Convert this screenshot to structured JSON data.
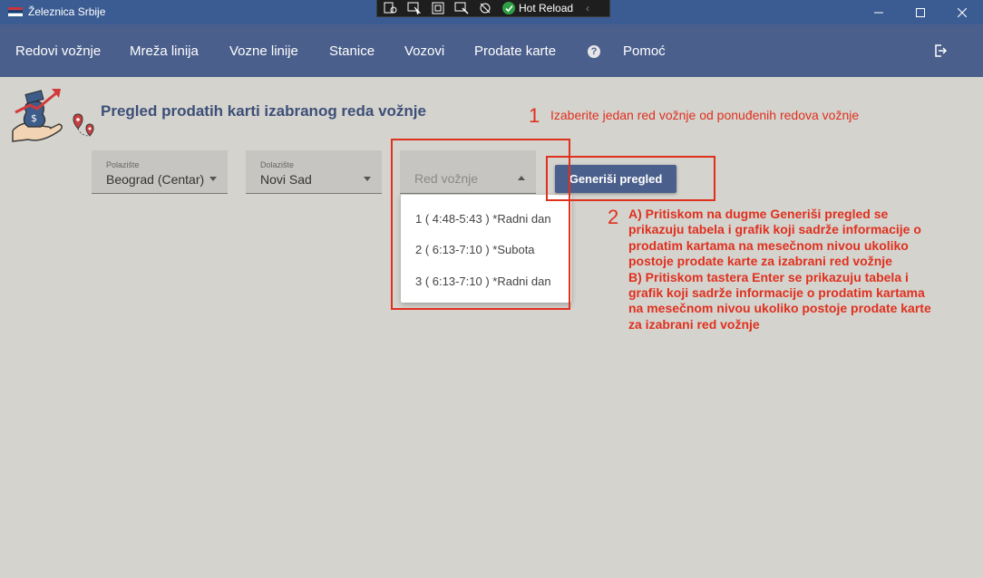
{
  "window": {
    "title": "Železnica Srbije",
    "flag_icon": "serbia-flag-icon",
    "controls": [
      "minimize-icon",
      "maximize-icon",
      "close-icon"
    ]
  },
  "debug_toolbar": {
    "icons": [
      "live-visual-tree-icon",
      "select-element-icon",
      "display-layout-adorners-icon",
      "track-focus-icon",
      "binding-failures-icon"
    ],
    "hot_reload_label": "Hot Reload"
  },
  "menu": {
    "items": [
      "Redovi vožnje",
      "Mreža linija",
      "Vozne linije",
      "Stanice",
      "Vozovi",
      "Prodate karte"
    ],
    "help_icon": "?",
    "help_label": "Pomoć",
    "logout_icon": "logout-icon"
  },
  "page": {
    "title": "Pregled prodatih karti izabranog reda vožnje",
    "logo_icon": "ticket-sales-logo-icon"
  },
  "filters": {
    "departure": {
      "label": "Polazište",
      "value": "Beograd (Centar)"
    },
    "arrival": {
      "label": "Dolazište",
      "value": "Novi Sad"
    },
    "schedule": {
      "placeholder": "Red vožnje",
      "options": [
        "1 ( 4:48-5:43 ) *Radni dan",
        "2 ( 6:13-7:10 ) *Subota",
        "3 ( 6:13-7:10 ) *Radni dan"
      ]
    }
  },
  "generate_button": {
    "label": "Generiši pregled"
  },
  "annotations": {
    "step1_number": "1",
    "step1_text": "Izaberite jedan red vožnje od ponuđenih redova vožnje",
    "step2_number": "2",
    "step2_lines": [
      "A) Pritiskom na dugme Generiši pregled se",
      "prikazuju tabela i grafik koji sadrže informacije o",
      "prodatim kartama na mesečnom nivou ukoliko",
      "postoje prodate karte za izabrani red vožnje",
      "B) Pritiskom tastera Enter se prikazuju tabela i",
      "grafik koji sadrže informacije o prodatim kartama",
      "na mesečnom nivou ukoliko postoje prodate karte",
      "za izabrani red vožnje"
    ],
    "highlight_color": "#e0301e"
  },
  "colors": {
    "titlebar": "#3b5c93",
    "menubar": "#4b5f8c",
    "background": "#d4d3ce",
    "title_text": "#3d4f78"
  }
}
